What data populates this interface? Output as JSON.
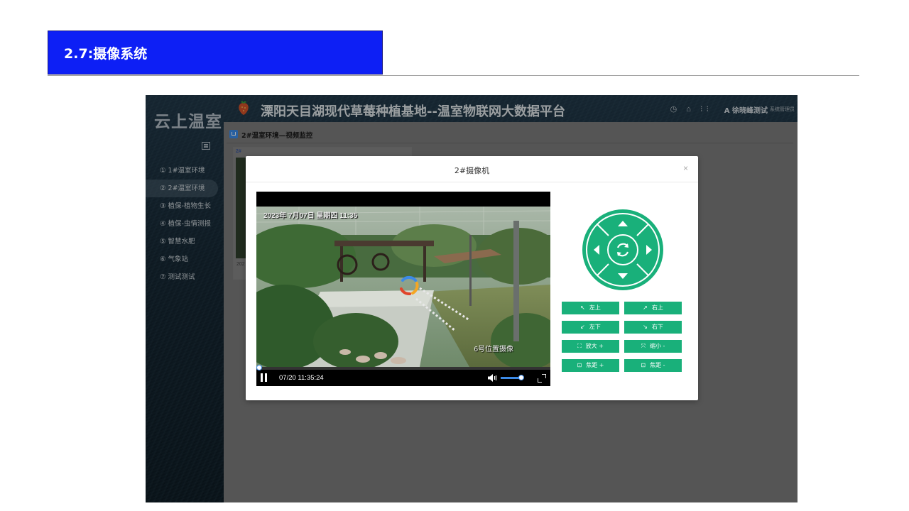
{
  "slide": {
    "title": "2.7:摄像系统"
  },
  "app": {
    "brand": "云上温室",
    "title": "溧阳天目湖现代草莓种植基地--温室物联网大数据平台",
    "top_icons": "◷ ⌂ ⁝⁝",
    "user": "A 徐晓峰测试",
    "role": "系统管理员"
  },
  "nav": {
    "items": [
      {
        "label": "① 1#温室环境"
      },
      {
        "label": "② 2#温室环境"
      },
      {
        "label": "③ 植保-植物生长"
      },
      {
        "label": "④ 植保-虫情测报"
      },
      {
        "label": "⑤ 智慧水肥"
      },
      {
        "label": "⑥ 气象站"
      },
      {
        "label": "⑦ 测试测试"
      }
    ]
  },
  "breadcrumb": {
    "label": "2#温室环境—视频监控"
  },
  "card": {
    "label": "2#",
    "date": "202"
  },
  "modal": {
    "title": "2#摄像机",
    "close": "×",
    "video": {
      "osd_date": "2023年 7月07日 星期四 11:35",
      "osd_camera": "6号位置摄像",
      "time": "07/20 11:35:24",
      "volume": 0.8
    },
    "buttons": [
      {
        "icon": "↖",
        "label": "左上"
      },
      {
        "icon": "↗",
        "label": "右上"
      },
      {
        "icon": "↙",
        "label": "左下"
      },
      {
        "icon": "↘",
        "label": "右下"
      },
      {
        "icon": "⛶",
        "label": "放大 +"
      },
      {
        "icon": "⤧",
        "label": "缩小 -"
      },
      {
        "icon": "⊡",
        "label": "焦距 +"
      },
      {
        "icon": "⊡",
        "label": "焦距 -"
      }
    ]
  },
  "colors": {
    "slide_title_bg": "#0d1ff5",
    "accent_green": "#19b07a",
    "accent_blue": "#3c8ae6"
  }
}
